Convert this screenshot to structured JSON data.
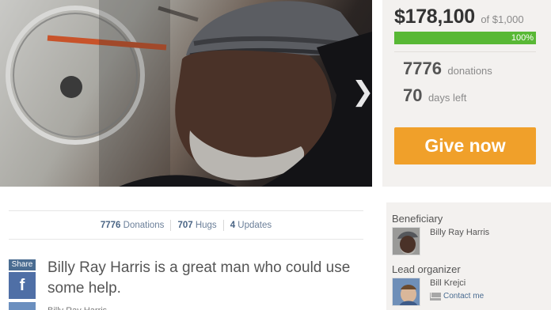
{
  "campaign": {
    "raised_amount": "$178,100",
    "goal_text": "of $1,000",
    "progress_label": "100%",
    "progress_fraction": 1.0,
    "donations_count": "7776",
    "donations_label": "donations",
    "days_left_count": "70",
    "days_left_label": "days left",
    "give_button": "Give now"
  },
  "counts_bar": {
    "donations_num": "7776",
    "donations_label": "Donations",
    "hugs_num": "707",
    "hugs_label": "Hugs",
    "updates_num": "4",
    "updates_label": "Updates"
  },
  "share": {
    "label": "Share",
    "facebook_glyph": "f"
  },
  "story": {
    "title": "Billy Ray Harris is a great man who could use some help.",
    "excerpt": "Billy Ray Harris"
  },
  "people": {
    "beneficiary_heading": "Beneficiary",
    "beneficiary_name": "Billy Ray Harris",
    "organizer_heading": "Lead organizer",
    "organizer_name": "Bill Krejci",
    "contact_label": "Contact me"
  },
  "hero": {
    "next_glyph": "❯"
  },
  "colors": {
    "accent_orange": "#f0a02a",
    "progress_green": "#58b835",
    "link_blue": "#4a6c91",
    "facebook_blue": "#4f6fa6"
  },
  "icons": [
    "chevron-right-icon",
    "facebook-icon",
    "mail-icon"
  ]
}
